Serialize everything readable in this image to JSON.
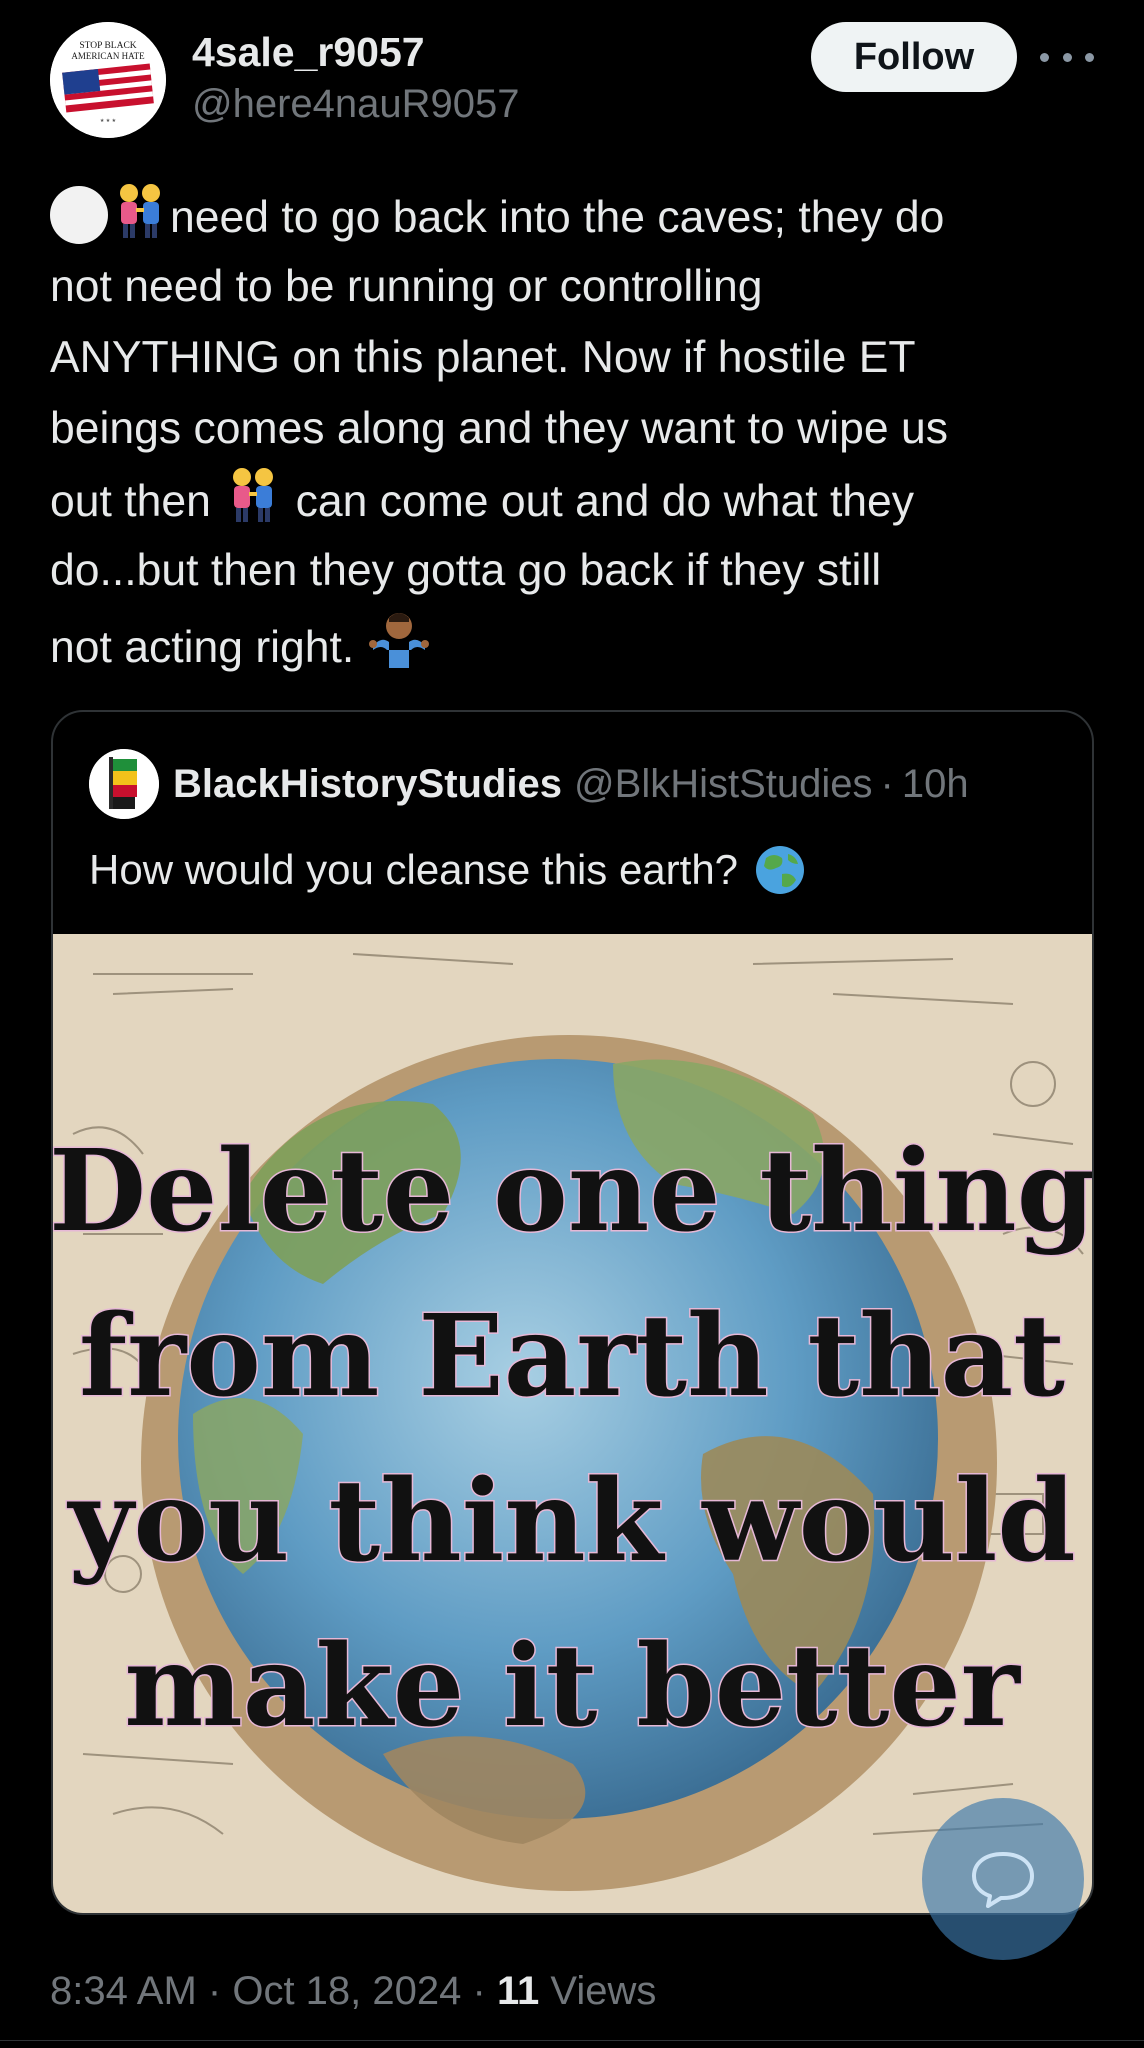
{
  "author": {
    "display_name": "4sale_r9057",
    "handle": "@here4nauR9057",
    "avatar_text": "STOP BLACK AMERICAN HATE"
  },
  "actions": {
    "follow_label": "Follow",
    "more_icon": "more-dots-icon"
  },
  "post": {
    "line1": "need to go back into the caves; they do",
    "line2": "not need to be running or controlling",
    "line3": "ANYTHING on this planet. Now if hostile ET",
    "line4": "beings comes along and they want to wipe us",
    "line5a": "out then",
    "line5b": "can come out and do what they",
    "line6": "do...but then they gotta go back if they still",
    "line7": "not acting right."
  },
  "quote": {
    "display_name": "BlackHistoryStudies",
    "handle": "@BlkHistStudies",
    "separator": "·",
    "time": "10h",
    "text": "How would you cleanse this earth?",
    "image_caption": {
      "l1": "Delete one thing",
      "l2": "from Earth that",
      "l3": "you think would",
      "l4": "make it better"
    }
  },
  "meta": {
    "time": "8:34 AM",
    "sep1": "·",
    "date": "Oct 18, 2024",
    "sep2": "·",
    "views_count": "11",
    "views_label": "Views"
  },
  "colors": {
    "background": "#000000",
    "text": "#e7e9ea",
    "secondary": "#71767b",
    "follow_bg": "#eff3f4",
    "border": "#2f3336"
  }
}
